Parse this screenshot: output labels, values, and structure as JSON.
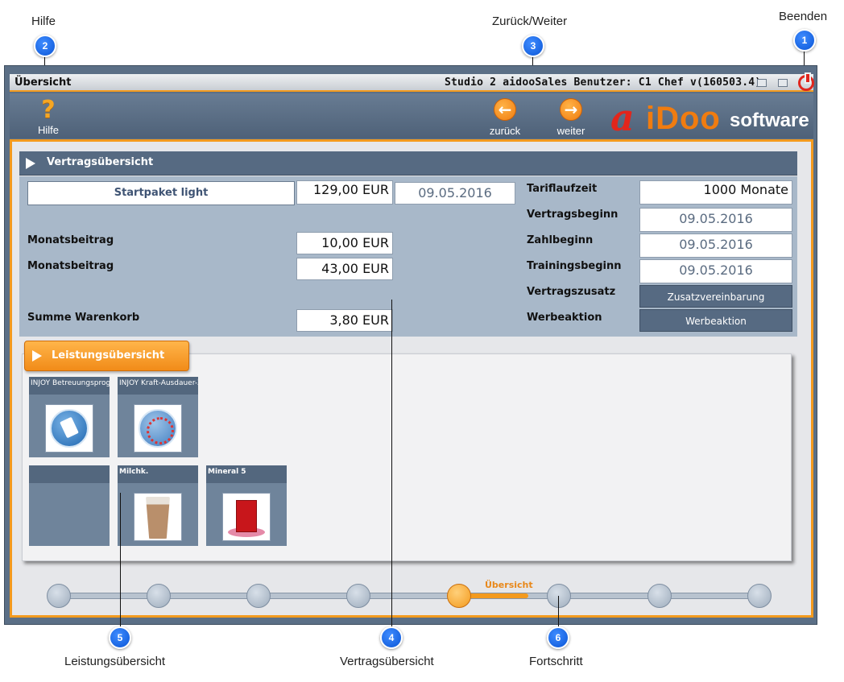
{
  "callouts": {
    "hilfe": {
      "label": "Hilfe",
      "number": "2"
    },
    "nav": {
      "label": "Zurück/Weiter",
      "number": "3"
    },
    "beenden": {
      "label": "Beenden",
      "number": "1"
    },
    "leistung": {
      "label": "Leistungsübersicht",
      "number": "5"
    },
    "vertrag": {
      "label": "Vertragsübersicht",
      "number": "4"
    },
    "fortschritt": {
      "label": "Fortschritt",
      "number": "6"
    }
  },
  "window": {
    "title_left": "Übersicht",
    "title_right": "Studio 2 aidooSales Benutzer: C1 Chef v(160503.4)"
  },
  "toolbar": {
    "help_icon": "?",
    "help_label": "Hilfe",
    "back_icon": "arrow-left-icon",
    "back_label": "zurück",
    "forward_icon": "arrow-right-icon",
    "forward_label": "weiter",
    "logo_mark": "a",
    "logo_name": "iDoo",
    "logo_suffix": "software"
  },
  "contract": {
    "header": "Vertragsübersicht",
    "package": "Startpaket light",
    "package_price": "129,00 EUR",
    "package_date": "09.05.2016",
    "rows": [
      {
        "label": "Monatsbeitrag",
        "value": "10,00 EUR"
      },
      {
        "label": "Monatsbeitrag",
        "value": "43,00 EUR"
      },
      {
        "label": "Summe Warenkorb",
        "value": "3,80 EUR"
      }
    ],
    "right": {
      "tariflaufzeit_label": "Tariflaufzeit",
      "tariflaufzeit_value": "1000 Monate",
      "vertragsbeginn_label": "Vertragsbeginn",
      "vertragsbeginn_value": "09.05.2016",
      "zahlbeginn_label": "Zahlbeginn",
      "zahlbeginn_value": "09.05.2016",
      "trainingsbeginn_label": "Trainingsbeginn",
      "trainingsbeginn_value": "09.05.2016",
      "vertragszusatz_label": "Vertragszusatz",
      "vertragszusatz_button": "Zusatzvereinbarung",
      "werbeaktion_label": "Werbeaktion",
      "werbeaktion_button": "Werbeaktion"
    }
  },
  "services": {
    "header": "Leistungsübersicht",
    "tiles": [
      {
        "caption": "INJOY Betreuungsprogramm"
      },
      {
        "caption": "INJOY Kraft-Ausdauer-Zirkel"
      },
      {
        "caption": ""
      },
      {
        "caption": "Milchk."
      },
      {
        "caption": "Mineral"
      }
    ],
    "badge_mineral": "5"
  },
  "progress": {
    "steps": 8,
    "active_step": 5,
    "active_label": "Übersicht"
  },
  "colors": {
    "accent": "#f39a1e",
    "panel": "#566a82",
    "window": "#5b6f86",
    "callout": "#0a55d6"
  }
}
